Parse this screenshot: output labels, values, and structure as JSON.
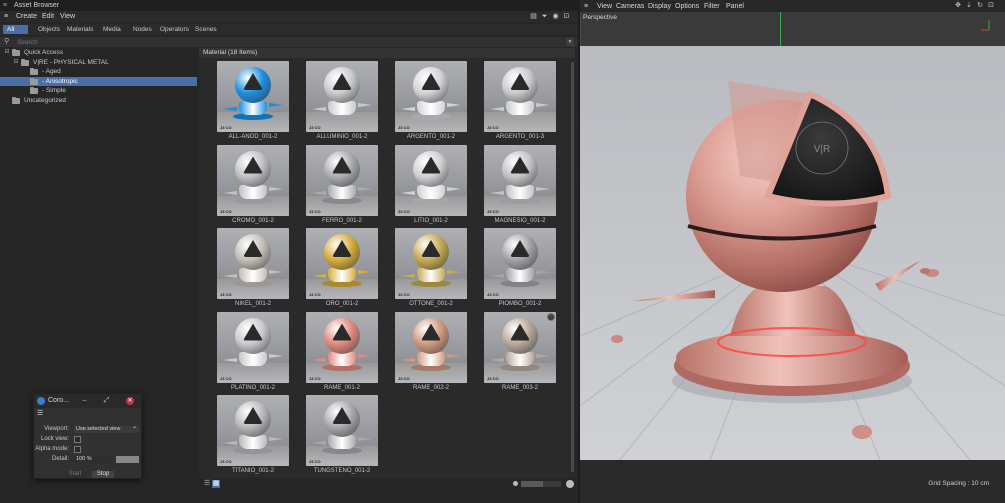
{
  "left_panel": {
    "title": "Asset Browser",
    "menu": [
      "Create",
      "Edit",
      "View"
    ],
    "tabs": [
      {
        "label": "All",
        "active": true
      },
      {
        "label": "Objects",
        "active": false
      },
      {
        "label": "Materials",
        "active": false
      },
      {
        "label": "Media",
        "active": false
      },
      {
        "label": "Nodes",
        "active": false
      },
      {
        "label": "Operators",
        "active": false
      },
      {
        "label": "Scenes",
        "active": false
      }
    ],
    "search": {
      "placeholder": "Search",
      "value": ""
    },
    "tree": [
      {
        "label": "Quick Access",
        "depth": 0,
        "toggle": "⊟",
        "selected": false
      },
      {
        "label": "V|RE - PHYSICAL METAL",
        "depth": 1,
        "toggle": "⊟",
        "selected": false
      },
      {
        "label": "- Aged",
        "depth": 2,
        "toggle": "",
        "selected": false
      },
      {
        "label": "- Anisotropic",
        "depth": 2,
        "toggle": "",
        "selected": true
      },
      {
        "label": "- Simple",
        "depth": 2,
        "toggle": "",
        "selected": false
      },
      {
        "label": "Uncategorized",
        "depth": 0,
        "toggle": "",
        "selected": false
      }
    ],
    "grid_header": "Material (18 Items)",
    "materials": [
      {
        "label": "ALL-ANOD_001-2",
        "color": "#1c8fe0",
        "favorite": false
      },
      {
        "label": "ALLUMINIO_001-2",
        "color": "#c8cacd",
        "favorite": false
      },
      {
        "label": "ARGENTO_001-2",
        "color": "#d2d3d6",
        "favorite": false
      },
      {
        "label": "ARGENTO_001-3",
        "color": "#c9cacd",
        "favorite": false
      },
      {
        "label": "CROMO_001-2",
        "color": "#bfc1c5",
        "favorite": false
      },
      {
        "label": "FERRO_001-2",
        "color": "#a9abaf",
        "favorite": false
      },
      {
        "label": "LITIO_001-2",
        "color": "#cfd0d3",
        "favorite": false
      },
      {
        "label": "MAGNESIO_001-2",
        "color": "#c2c3c6",
        "favorite": false
      },
      {
        "label": "NIKEL_001-2",
        "color": "#c4beb6",
        "favorite": false
      },
      {
        "label": "ORO_001-2",
        "color": "#d6ac3a",
        "favorite": false
      },
      {
        "label": "OTTONE_001-2",
        "color": "#c4aa52",
        "favorite": false
      },
      {
        "label": "PIOMBO_001-2",
        "color": "#a3a4a8",
        "favorite": false
      },
      {
        "label": "PLATINO_001-2",
        "color": "#c8c9cc",
        "favorite": false
      },
      {
        "label": "RAME_001-2",
        "color": "#e08a80",
        "favorite": false
      },
      {
        "label": "RAME_002-2",
        "color": "#cf9a7e",
        "favorite": false
      },
      {
        "label": "RAME_003-2",
        "color": "#b7a79a",
        "favorite": true
      },
      {
        "label": "TITANIO_001-2",
        "color": "#b8b9bc",
        "favorite": false
      },
      {
        "label": "TUNGSTENO_001-2",
        "color": "#a8a9ad",
        "favorite": false
      }
    ],
    "thumb_logo": "J3 CO"
  },
  "dialog": {
    "title": "Coro...",
    "viewport_label": "Viewport:",
    "viewport_value": "Use selected view",
    "lock_label": "Lock view:",
    "alpha_label": "Alpha mode:",
    "detail_label": "Detail:",
    "detail_value": "100 %",
    "start_label": "Start",
    "stop_label": "Stop"
  },
  "viewport": {
    "menu": [
      "View",
      "Cameras",
      "Display",
      "Options",
      "Filter",
      "Panel"
    ],
    "label": "Perspective",
    "grid_spacing": "Grid Spacing : 10 cm",
    "logo_text": "V|R",
    "accent_copper": "#e0a39a"
  }
}
